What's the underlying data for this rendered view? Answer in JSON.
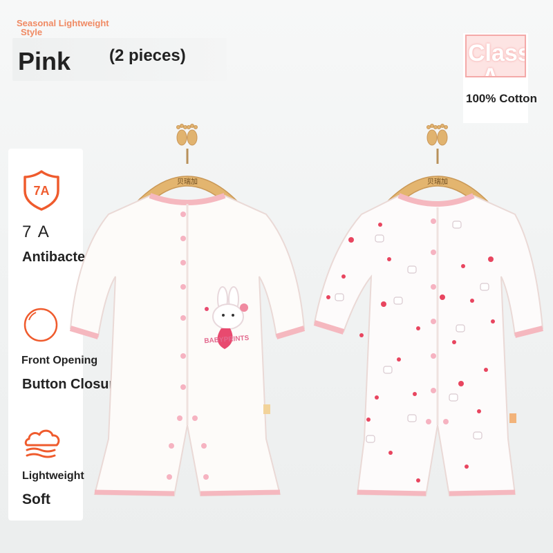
{
  "header": {
    "seasonal_line1": "Seasonal Lightweight",
    "seasonal_line2": "Style",
    "color_name": "Pink",
    "pieces": "(2 pieces)"
  },
  "badge": {
    "grade_line1": "Class",
    "grade_line2": "A",
    "material": "100% Cotton"
  },
  "features": [
    {
      "icon": "shield-7a-icon",
      "badge_text": "7A",
      "title": "7 A",
      "subtitle": "Antibacterial"
    },
    {
      "icon": "circle-icon",
      "title": "Front Opening",
      "subtitle": "Button Closure"
    },
    {
      "icon": "cloud-icon",
      "title": "Lightweight",
      "subtitle": "Soft"
    }
  ],
  "products": [
    {
      "name": "rabbit-print-romper",
      "hanger_brand": "贝瑞加",
      "print_text": "BABYPRINTS"
    },
    {
      "name": "strawberry-pattern-romper",
      "hanger_brand": "贝瑞加"
    }
  ],
  "colors": {
    "accent_orange": "#f08a63",
    "icon_orange": "#ef5b2d",
    "trim_pink": "#f5b8bf",
    "text_dark": "#222222"
  }
}
